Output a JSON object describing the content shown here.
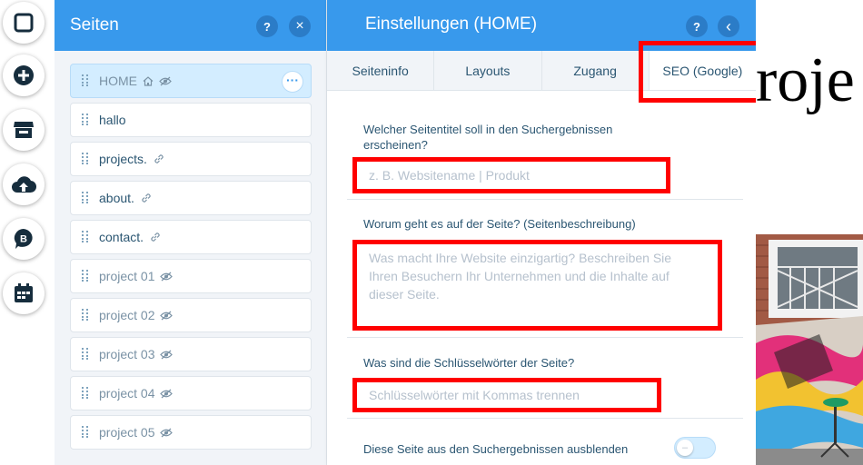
{
  "pages_panel": {
    "title": "Seiten",
    "help_label": "?",
    "close_label": "×",
    "more_label": "···",
    "items": [
      {
        "label": "HOME",
        "icons": [
          "home-icon",
          "hidden-eye-icon"
        ],
        "selected": true
      },
      {
        "label": "hallo",
        "icons": []
      },
      {
        "label": "projects.",
        "icons": [
          "link-icon"
        ]
      },
      {
        "label": "about.",
        "icons": [
          "link-icon"
        ]
      },
      {
        "label": "contact.",
        "icons": [
          "link-icon"
        ]
      },
      {
        "label": "project 01",
        "icons": [
          "hidden-eye-icon"
        ]
      },
      {
        "label": "project 02",
        "icons": [
          "hidden-eye-icon"
        ]
      },
      {
        "label": "project 03",
        "icons": [
          "hidden-eye-icon"
        ]
      },
      {
        "label": "project 04",
        "icons": [
          "hidden-eye-icon"
        ]
      },
      {
        "label": "project 05",
        "icons": [
          "hidden-eye-icon"
        ]
      }
    ]
  },
  "settings_panel": {
    "title": "Einstellungen (HOME)",
    "help_label": "?",
    "back_label": "‹",
    "tabs": [
      {
        "label": "Seiteninfo"
      },
      {
        "label": "Layouts"
      },
      {
        "label": "Zugang"
      },
      {
        "label": "SEO (Google)",
        "active": true
      }
    ],
    "seo": {
      "title_question": "Welcher Seitentitel soll in den Suchergebnissen erscheinen?",
      "title_placeholder": "z. B. Websitename | Produkt",
      "description_question": "Worum geht es auf der Seite? (Seitenbeschreibung)",
      "description_placeholder": "Was macht Ihre Website einzigartig? Beschreiben Sie Ihren Besuchern Ihr Unternehmen und die Inhalte auf dieser Seite.",
      "keywords_question": "Was sind die Schlüsselwörter der Seite?",
      "keywords_placeholder": "Schlüsselwörter mit Kommas trennen",
      "hide_label": "Diese Seite aus den Suchergebnissen ausblenden",
      "hide_toggle_on": false
    }
  },
  "site_preview": {
    "heading_fragment": "roje"
  },
  "colors": {
    "accent": "#3899ec",
    "highlight": "#ff0000",
    "text": "#2b5672"
  }
}
